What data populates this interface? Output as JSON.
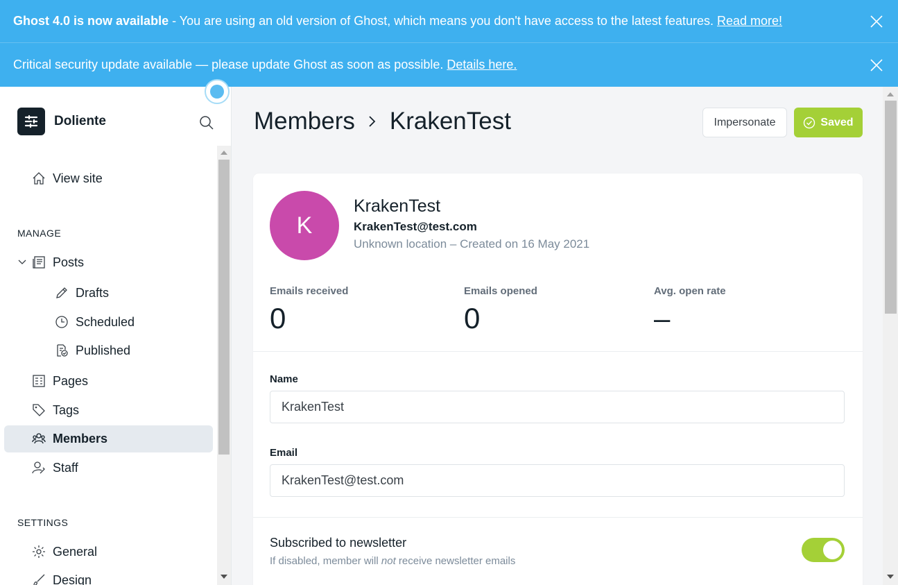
{
  "banners": {
    "upgrade": {
      "bold": "Ghost 4.0 is now available",
      "text": " - You are using an old version of Ghost, which means you don't have access to the latest features. ",
      "link": "Read more!"
    },
    "security": {
      "text": "Critical security update available — please update Ghost as soon as possible. ",
      "link": "Details here."
    }
  },
  "sidebar": {
    "brand": "Doliente",
    "view_site": "View site",
    "manage_label": "MANAGE",
    "posts": "Posts",
    "drafts": "Drafts",
    "scheduled": "Scheduled",
    "published": "Published",
    "pages": "Pages",
    "tags": "Tags",
    "members": "Members",
    "staff": "Staff",
    "settings_label": "SETTINGS",
    "general": "General",
    "design": "Design"
  },
  "header": {
    "section": "Members",
    "member": "KrakenTest",
    "impersonate": "Impersonate",
    "saved": "Saved"
  },
  "member": {
    "initial": "K",
    "name": "KrakenTest",
    "email": "KrakenTest@test.com",
    "meta": "Unknown location – Created on 16 May 2021"
  },
  "stats": {
    "received_label": "Emails received",
    "received_value": "0",
    "opened_label": "Emails opened",
    "opened_value": "0",
    "rate_label": "Avg. open rate",
    "rate_value": "–"
  },
  "form": {
    "name_label": "Name",
    "name_value": "KrakenTest",
    "email_label": "Email",
    "email_value": "KrakenTest@test.com"
  },
  "newsletter": {
    "title": "Subscribed to newsletter",
    "desc_before": "If disabled, member will ",
    "desc_em": "not",
    "desc_after": " receive newsletter emails",
    "enabled": true
  },
  "colors": {
    "banner": "#3eb0ef",
    "accent_green": "#a4d037",
    "avatar": "#c94aab"
  }
}
